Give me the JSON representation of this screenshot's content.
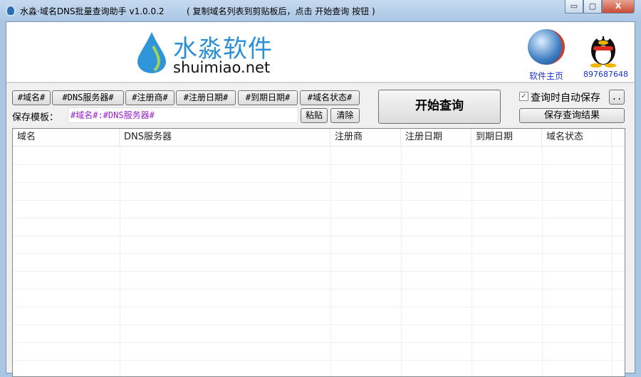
{
  "window": {
    "title": "水淼·域名DNS批量查询助手 v1.0.0.2",
    "hint": "( 复制域名列表到剪贴板后，点击 开始查询 按钮 )",
    "minimize": "▭",
    "maximize": "▢",
    "close": "X"
  },
  "header": {
    "logo_cn": "水淼软件",
    "logo_en": "shuimiao.net",
    "homepage_label": "软件主页",
    "qq_label": "897687648"
  },
  "toolbar": {
    "tags": [
      "#域名#",
      "#DNS服务器#",
      "#注册商#",
      "#注册日期#",
      "#到期日期#",
      "#域名状态#"
    ],
    "template_label": "保存模板：",
    "template_value": "#域名#:#DNS服务器#",
    "paste": "粘贴",
    "clear": "清除",
    "start": "开始查询",
    "auto_save_label": "查询时自动保存",
    "auto_save_checked": true,
    "more": "..",
    "save_results": "保存查询结果"
  },
  "table": {
    "columns": [
      "域名",
      "DNS服务器",
      "注册商",
      "注册日期",
      "到期日期",
      "域名状态"
    ],
    "rows": []
  }
}
